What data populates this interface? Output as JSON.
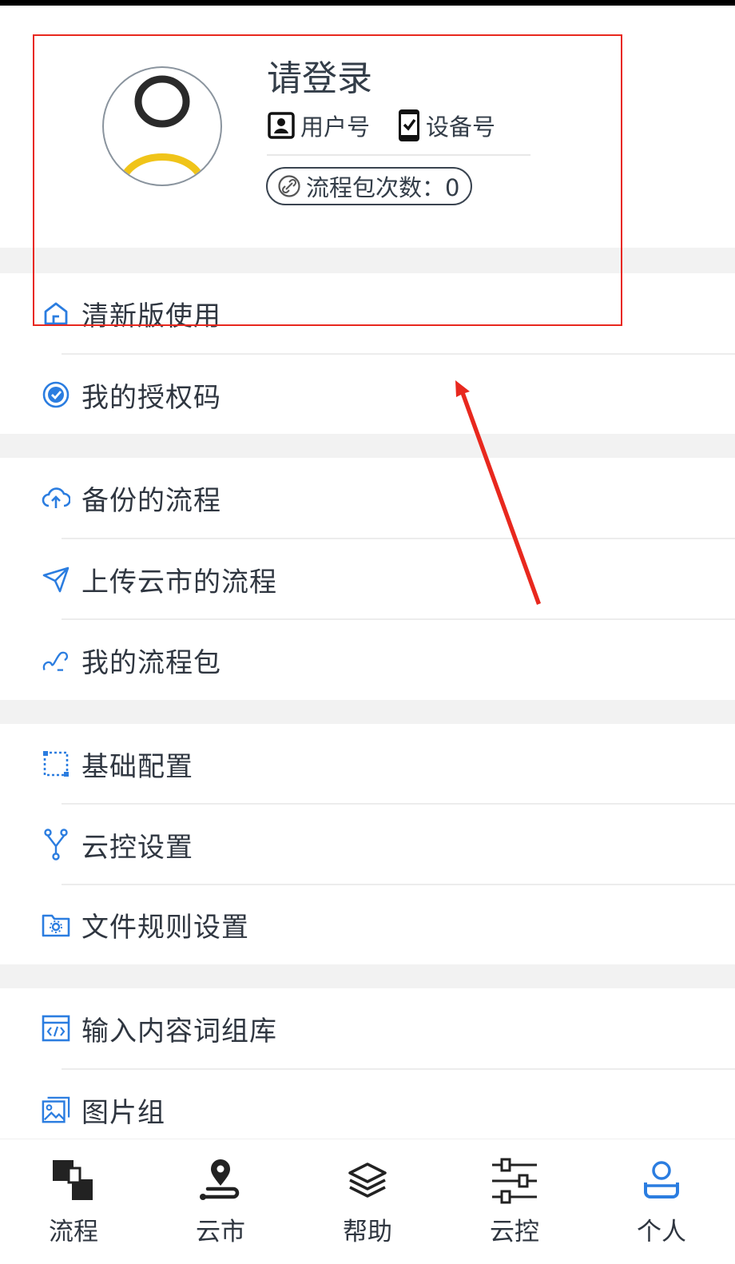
{
  "profile": {
    "login_title": "请登录",
    "user_id_label": "用户号",
    "device_id_label": "设备号",
    "package_count_label": "流程包次数：0"
  },
  "menu": {
    "section1": [
      {
        "label": "清新版使用",
        "icon": "home-outline-icon"
      },
      {
        "label": "我的授权码",
        "icon": "verified-badge-icon"
      }
    ],
    "section2": [
      {
        "label": "备份的流程",
        "icon": "cloud-upload-icon"
      },
      {
        "label": "上传云市的流程",
        "icon": "send-icon"
      },
      {
        "label": "我的流程包",
        "icon": "route-icon"
      }
    ],
    "section3": [
      {
        "label": "基础配置",
        "icon": "dashed-square-icon"
      },
      {
        "label": "云控设置",
        "icon": "fork-icon"
      },
      {
        "label": "文件规则设置",
        "icon": "folder-gear-icon"
      }
    ],
    "section4": [
      {
        "label": "输入内容词组库",
        "icon": "code-window-icon"
      },
      {
        "label": "图片组",
        "icon": "image-stack-icon"
      }
    ]
  },
  "bottom_nav": [
    {
      "label": "流程",
      "icon": "flow-blocks-icon"
    },
    {
      "label": "云市",
      "icon": "map-pin-route-icon"
    },
    {
      "label": "帮助",
      "icon": "layers-icon"
    },
    {
      "label": "云控",
      "icon": "sliders-icon"
    },
    {
      "label": "个人",
      "icon": "person-icon",
      "active": true
    }
  ],
  "colors": {
    "accent": "#2b7de0",
    "annotation": "#e8281e",
    "avatar_ring": "#f0c419",
    "section_gap": "#f2f2f2"
  }
}
